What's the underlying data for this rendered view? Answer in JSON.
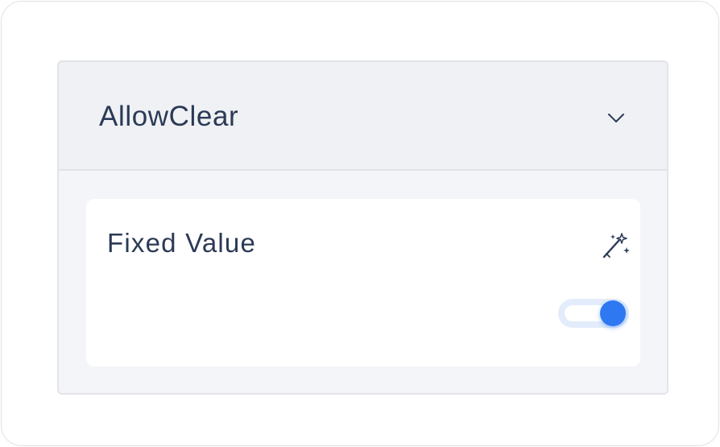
{
  "panel": {
    "title": "AllowClear",
    "collapse_icon": "chevron-down-icon"
  },
  "field": {
    "label": "Fixed Value",
    "action_icon": "magic-wand-icon",
    "toggle_on": true
  },
  "colors": {
    "accent": "#2e78f2",
    "text": "#2b3a55",
    "panel_bg": "#f3f5f8",
    "header_bg": "#eff1f4"
  }
}
